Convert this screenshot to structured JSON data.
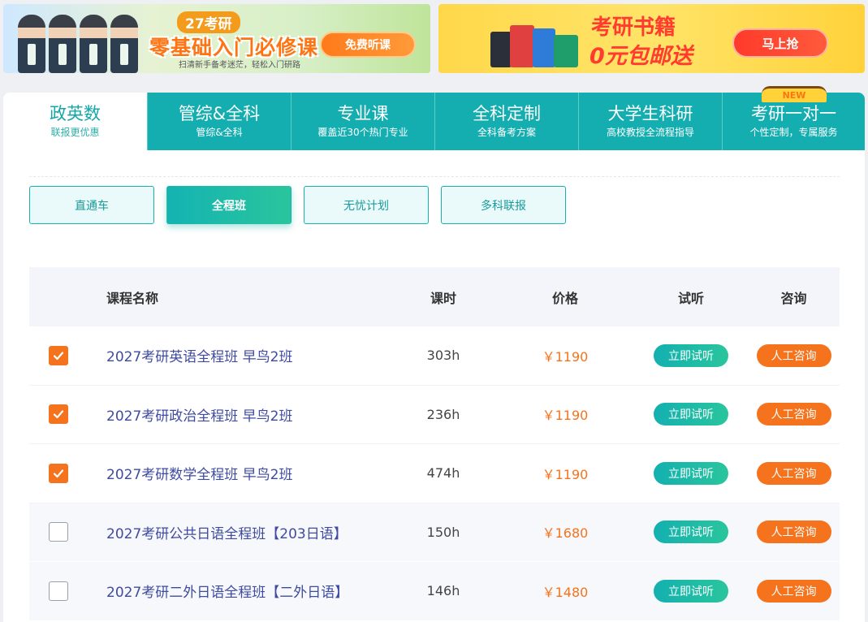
{
  "banners": {
    "left": {
      "badge": "27考研",
      "headline": "零基础入门必修课",
      "subline": "扫清新手备考迷茫，轻松入门研路",
      "button": "免费听课"
    },
    "right": {
      "headline_1": "考研书籍",
      "headline_2": "0元包邮送",
      "button": "马上抢"
    }
  },
  "tabs": [
    {
      "title": "政英数",
      "sub": "联报更优惠"
    },
    {
      "title": "管综&全科",
      "sub": "管综&全科"
    },
    {
      "title": "专业课",
      "sub": "覆盖近30个热门专业"
    },
    {
      "title": "全科定制",
      "sub": "全科备考方案"
    },
    {
      "title": "大学生科研",
      "sub": "高校教授全流程指导"
    },
    {
      "title": "考研一对一",
      "sub": "个性定制，专属服务",
      "badge": "NEW"
    }
  ],
  "subtabs": [
    "直通车",
    "全程班",
    "无忧计划",
    "多科联报"
  ],
  "active_subtab": "全程班",
  "table": {
    "headers": {
      "name": "课程名称",
      "hours": "课时",
      "price": "价格",
      "trial": "试听",
      "consult": "咨询"
    },
    "rows": [
      {
        "checked": true,
        "name": "2027考研英语全程班 早鸟2班",
        "hours": "303h",
        "price": "￥1190",
        "trial": "立即试听",
        "consult": "人工咨询"
      },
      {
        "checked": true,
        "name": "2027考研政治全程班 早鸟2班",
        "hours": "236h",
        "price": "￥1190",
        "trial": "立即试听",
        "consult": "人工咨询"
      },
      {
        "checked": true,
        "name": "2027考研数学全程班 早鸟2班",
        "hours": "474h",
        "price": "￥1190",
        "trial": "立即试听",
        "consult": "人工咨询"
      },
      {
        "checked": false,
        "name": "2027考研公共日语全程班【203日语】",
        "hours": "150h",
        "price": "￥1680",
        "trial": "立即试听",
        "consult": "人工咨询"
      },
      {
        "checked": false,
        "name": "2027考研二外日语全程班【二外日语】",
        "hours": "146h",
        "price": "￥1480",
        "trial": "立即试听",
        "consult": "人工咨询"
      }
    ]
  },
  "colors": {
    "teal": "#14aeb0",
    "orange": "#f5731c",
    "link_blue": "#3f4ba0"
  }
}
